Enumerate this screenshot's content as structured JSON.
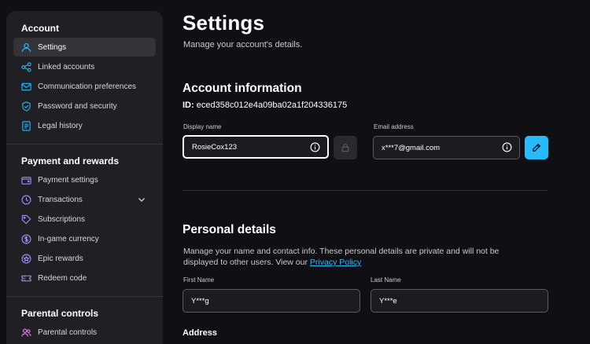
{
  "sidebar": {
    "account": {
      "title": "Account",
      "items": [
        {
          "label": "Settings",
          "icon": "user-icon",
          "active": true
        },
        {
          "label": "Linked accounts",
          "icon": "share-nodes-icon"
        },
        {
          "label": "Communication preferences",
          "icon": "envelope-icon"
        },
        {
          "label": "Password and security",
          "icon": "shield-check-icon"
        },
        {
          "label": "Legal history",
          "icon": "document-icon"
        }
      ]
    },
    "payment": {
      "title": "Payment and rewards",
      "items": [
        {
          "label": "Payment settings",
          "icon": "wallet-icon"
        },
        {
          "label": "Transactions",
          "icon": "clock-icon"
        },
        {
          "label": "Subscriptions",
          "icon": "tag-icon"
        },
        {
          "label": "In-game currency",
          "icon": "coin-icon"
        },
        {
          "label": "Epic rewards",
          "icon": "star-badge-icon"
        },
        {
          "label": "Redeem code",
          "icon": "ticket-icon"
        }
      ]
    },
    "parental": {
      "title": "Parental controls",
      "items": [
        {
          "label": "Parental controls",
          "icon": "users-icon"
        }
      ]
    }
  },
  "main": {
    "title": "Settings",
    "subtitle": "Manage your account's details.",
    "account_info": {
      "heading": "Account information",
      "id_label": "ID:",
      "id_value": "eced358c012e4a09ba02a1f204336175",
      "display_name_label": "Display name",
      "display_name_value": "RosieCox123",
      "email_label": "Email address",
      "email_value": "x***7@gmail.com"
    },
    "personal": {
      "heading": "Personal details",
      "description": "Manage your name and contact info. These personal details are private and will not be displayed to other users. View our",
      "privacy_link": "Privacy Policy",
      "first_name_label": "First Name",
      "first_name_value": "Y***g",
      "last_name_label": "Last Name",
      "last_name_value": "Y***e",
      "address_heading": "Address"
    }
  },
  "colors": {
    "background": "#101014",
    "sidebar": "#202024",
    "accent": "#26bbff"
  }
}
